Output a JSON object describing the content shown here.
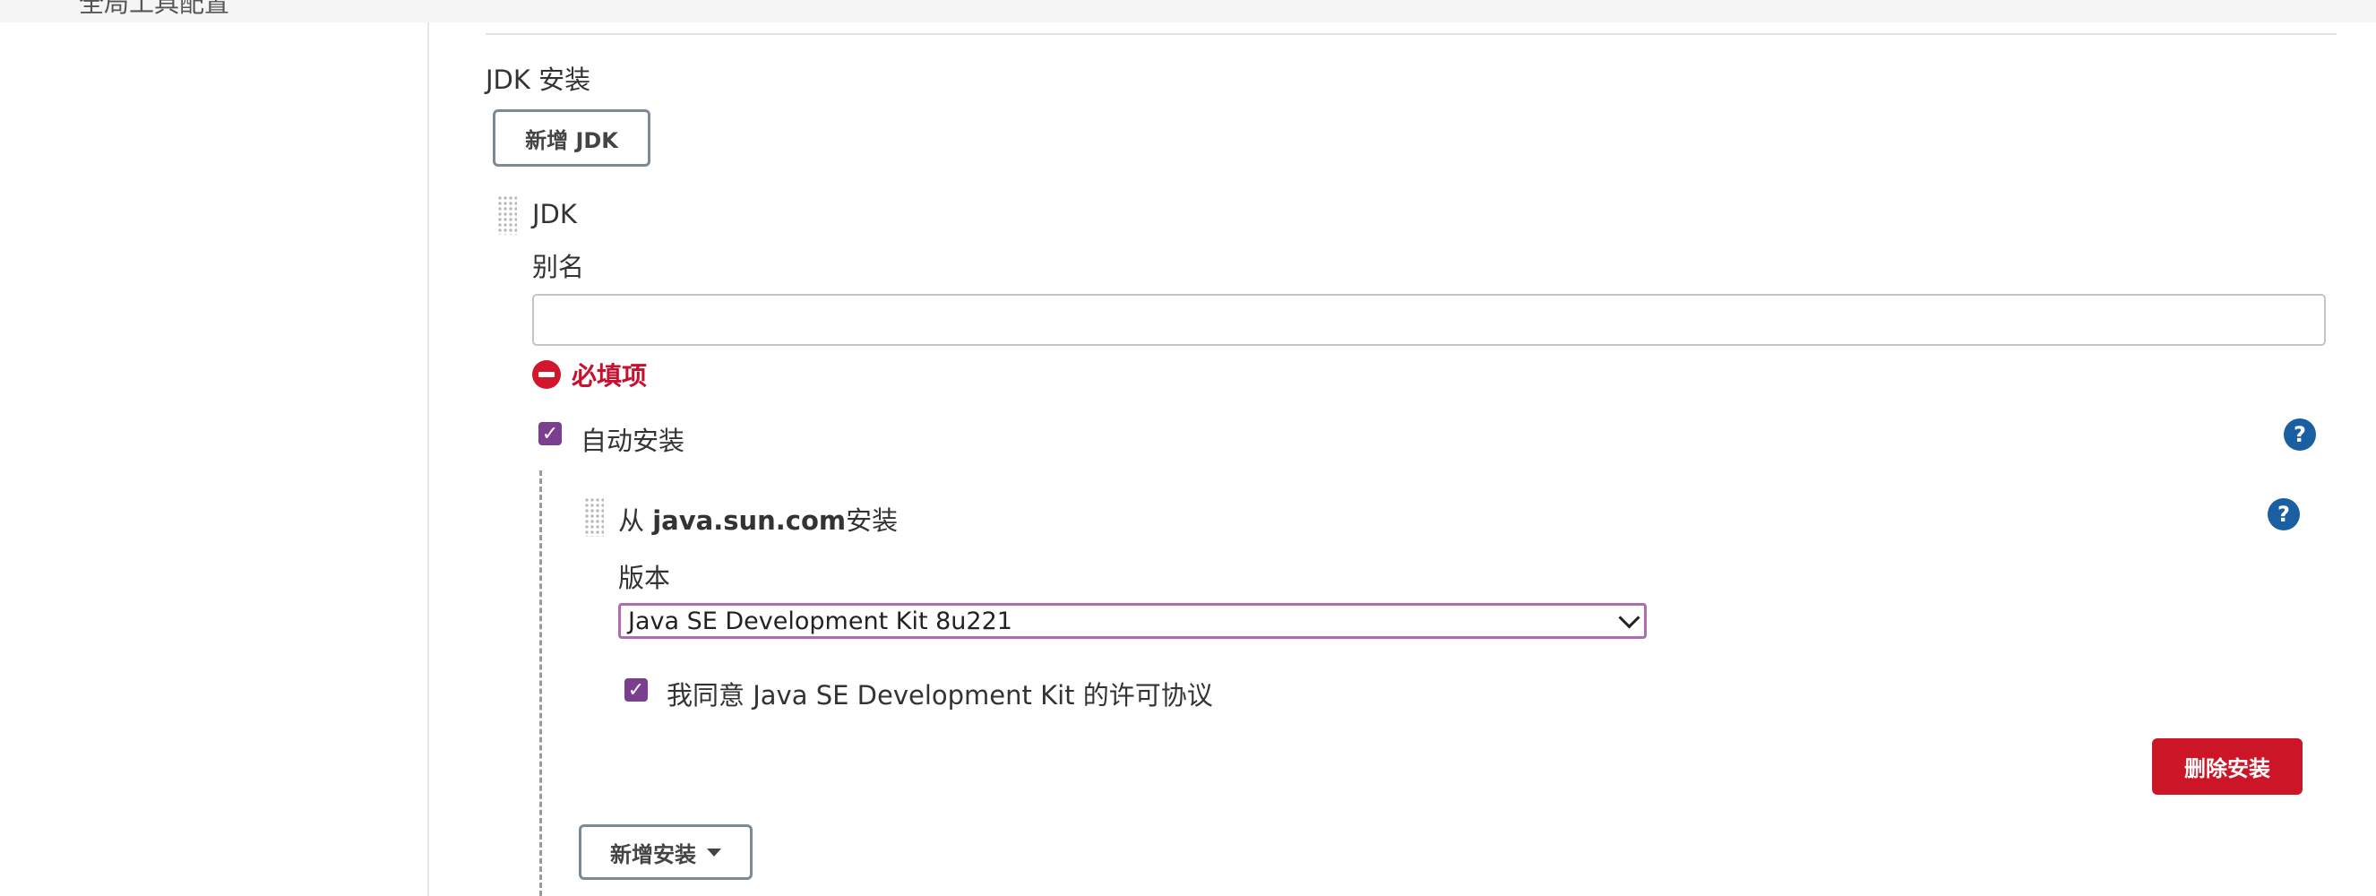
{
  "header": {
    "crumb": "全局工具配置"
  },
  "jdk_section": {
    "title": "JDK 安装",
    "add_button": "新增 JDK",
    "item": {
      "title": "JDK",
      "alias_label": "别名",
      "alias_value": "",
      "error_text": "必填项",
      "auto_install": {
        "label": "自动安装",
        "checked": true,
        "help": "?",
        "installer": {
          "title_prefix": "从 ",
          "title_source": "java.sun.com",
          "title_suffix": "安装",
          "help": "?",
          "version_label": "版本",
          "version_selected": "Java SE Development Kit 8u221",
          "license_label": "我同意 Java SE Development Kit 的许可协议",
          "license_checked": true,
          "delete_button": "删除安装"
        },
        "add_installer_button": "新增安装"
      }
    }
  },
  "colors": {
    "accent_purple": "#7b3f8f",
    "error_red": "#c8102e",
    "delete_red": "#cc1526",
    "help_blue": "#1b5fa3"
  },
  "icons": [
    "drag-handle-icon",
    "error-icon",
    "help-icon",
    "checkbox-icon",
    "chevron-down-icon",
    "caret-down-icon"
  ]
}
